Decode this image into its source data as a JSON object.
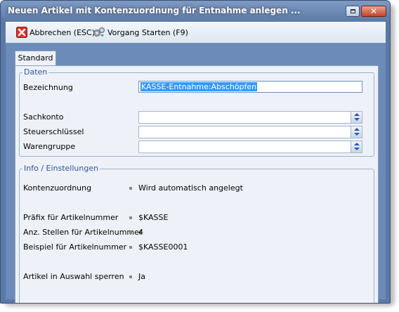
{
  "window": {
    "title": "Neuen Artikel mit Kontenzuordnung für Entnahme anlegen ...",
    "close_glyph": "✕"
  },
  "toolbar": {
    "cancel_label": "Abbrechen (ESC)",
    "start_label": "Vorgang Starten (F9)",
    "cancel_icon": "red-x-icon",
    "start_icon": "gears-icon"
  },
  "tab": {
    "label": "Standard"
  },
  "daten": {
    "title": "Daten",
    "bezeichnung_label": "Bezeichnung",
    "bezeichnung_value": "KASSE-Entnahme:Abschöpfen",
    "sachkonto_label": "Sachkonto",
    "steuerschluessel_label": "Steuerschlüssel",
    "warengruppe_label": "Warengruppe"
  },
  "info": {
    "title": "Info / Einstellungen",
    "rows": [
      {
        "label": "Kontenzuordnung",
        "value": "Wird automatisch angelegt"
      },
      {
        "label": "Präfix für Artikelnummer",
        "value": "$KASSE"
      },
      {
        "label": "Anz. Stellen für Artikelnummer",
        "value": "4"
      },
      {
        "label": "Beispiel für Artikelnummer",
        "value": "$KASSE0001"
      },
      {
        "label": "Artikel in Auswahl sperren",
        "value": "Ja"
      }
    ]
  },
  "colors": {
    "titlebar": "#5b79a6",
    "group_title": "#2d55a0",
    "selection": "#3399ff"
  }
}
